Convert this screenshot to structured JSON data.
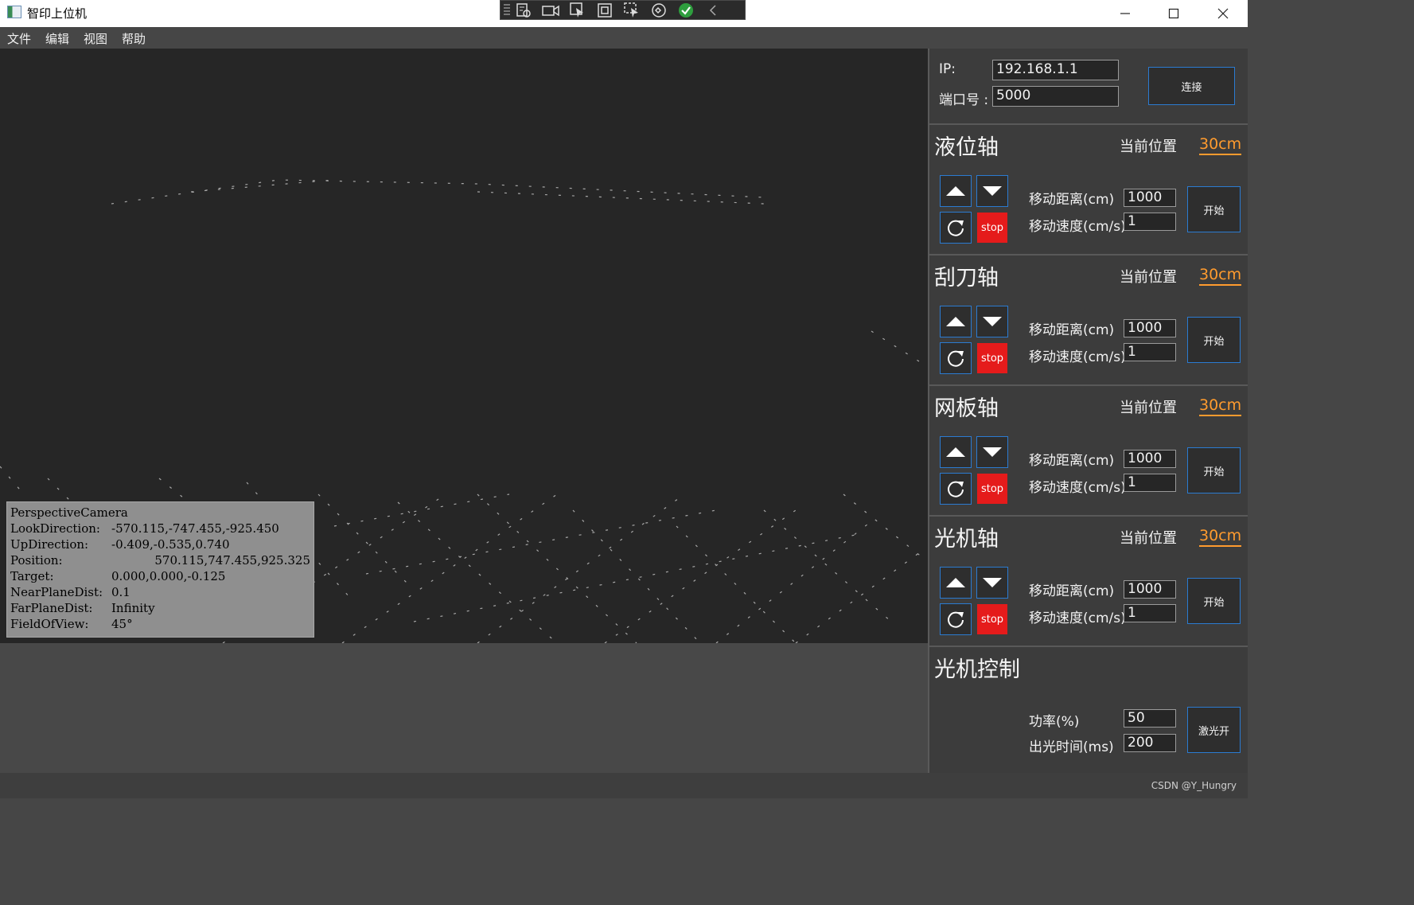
{
  "window": {
    "title": "智印上位机"
  },
  "menu": [
    "文件",
    "编辑",
    "视图",
    "帮助"
  ],
  "camera_info": [
    {
      "key": "PerspectiveCamera",
      "value": ""
    },
    {
      "key": "LookDirection:",
      "value": "-570.115,-747.455,-925.450"
    },
    {
      "key": "UpDirection:",
      "value": "-0.409,-0.535,0.740"
    },
    {
      "key": "Position:",
      "value": "570.115,747.455,925.325"
    },
    {
      "key": "Target:",
      "value": "0.000,0.000,-0.125"
    },
    {
      "key": "NearPlaneDist:",
      "value": "0.1"
    },
    {
      "key": "FarPlaneDist:",
      "value": "Infinity"
    },
    {
      "key": "FieldOfView:",
      "value": "45°"
    }
  ],
  "connection": {
    "ip_label": "IP:",
    "ip_value": "192.168.1.1",
    "port_label": "端口号 :",
    "port_value": "5000",
    "connect_label": "连接"
  },
  "axes": [
    {
      "title": "液位轴",
      "current_label": "当前位置",
      "current_value": "30cm",
      "distance_label": "移动距离(cm)",
      "distance_value": "1000",
      "speed_label": "移动速度(cm/s)",
      "speed_value": "1",
      "stop_label": "stop",
      "start_label": "开始"
    },
    {
      "title": "刮刀轴",
      "current_label": "当前位置",
      "current_value": "30cm",
      "distance_label": "移动距离(cm)",
      "distance_value": "1000",
      "speed_label": "移动速度(cm/s)",
      "speed_value": "1",
      "stop_label": "stop",
      "start_label": "开始"
    },
    {
      "title": "网板轴",
      "current_label": "当前位置",
      "current_value": "30cm",
      "distance_label": "移动距离(cm)",
      "distance_value": "1000",
      "speed_label": "移动速度(cm/s)",
      "speed_value": "1",
      "stop_label": "stop",
      "start_label": "开始"
    },
    {
      "title": "光机轴",
      "current_label": "当前位置",
      "current_value": "30cm",
      "distance_label": "移动距离(cm)",
      "distance_value": "1000",
      "speed_label": "移动速度(cm/s)",
      "speed_value": "1",
      "stop_label": "stop",
      "start_label": "开始"
    }
  ],
  "light_control": {
    "title": "光机控制",
    "power_label": "功率(%)",
    "power_value": "50",
    "time_label": "出光时间(ms)",
    "time_value": "200",
    "laser_label": "激光开"
  },
  "status": {
    "credit": "CSDN @Y_Hungry"
  },
  "colors": {
    "accent_orange": "#ff9b2e",
    "button_border": "#2b7bd1",
    "stop_red": "#e51b1b"
  }
}
